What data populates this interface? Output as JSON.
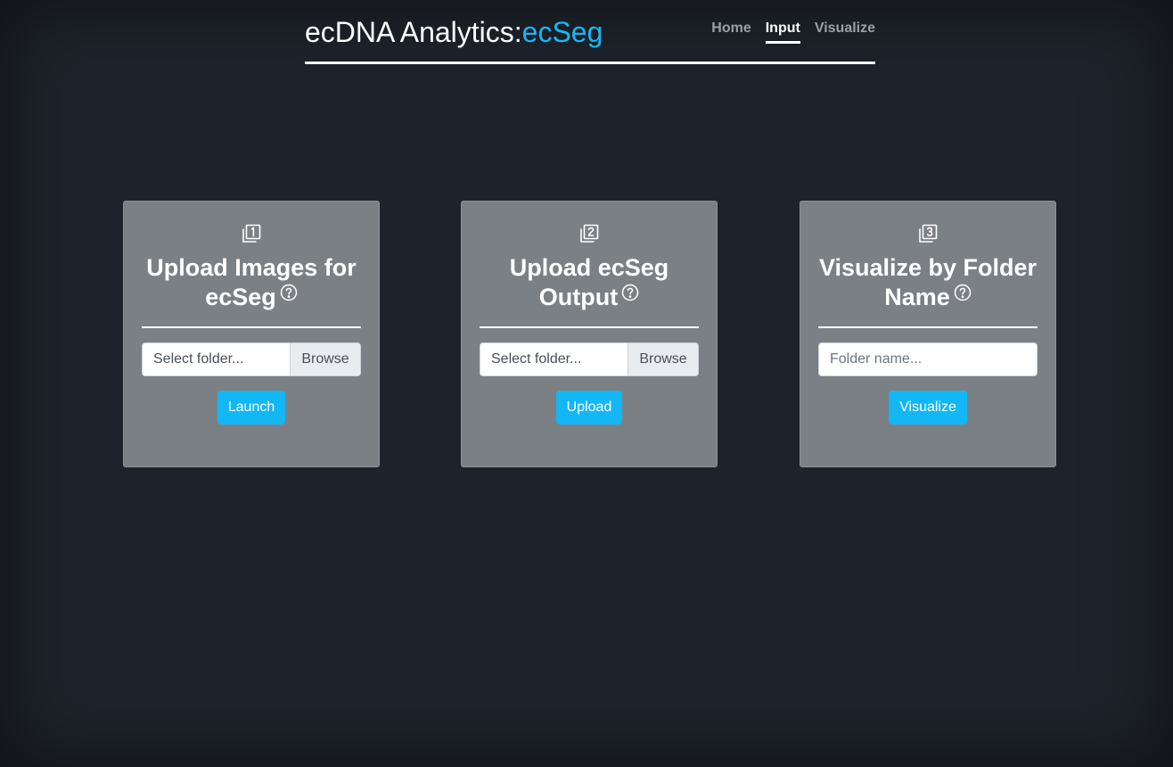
{
  "header": {
    "brand_prefix": "ecDNA Analytics:",
    "brand_accent": "ecSeg",
    "accent_color": "#1ab6f5",
    "nav": [
      {
        "label": "Home",
        "active": false
      },
      {
        "label": "Input",
        "active": true
      },
      {
        "label": "Visualize",
        "active": false
      }
    ]
  },
  "cards": [
    {
      "step_icon": "step-1-icon",
      "title": "Upload Images for ecSeg",
      "help_icon": "question-circle-icon",
      "file_label": "Select folder...",
      "browse_label": "Browse",
      "button_label": "Launch"
    },
    {
      "step_icon": "step-2-icon",
      "title": "Upload ecSeg Output",
      "help_icon": "question-circle-icon",
      "file_label": "Select folder...",
      "browse_label": "Browse",
      "button_label": "Upload"
    },
    {
      "step_icon": "step-3-icon",
      "title": "Visualize by Folder Name",
      "help_icon": "question-circle-icon",
      "input_placeholder": "Folder name...",
      "button_label": "Visualize"
    }
  ],
  "colors": {
    "background": "#1e232b",
    "card": "#7b8085",
    "button": "#13b7f5"
  }
}
